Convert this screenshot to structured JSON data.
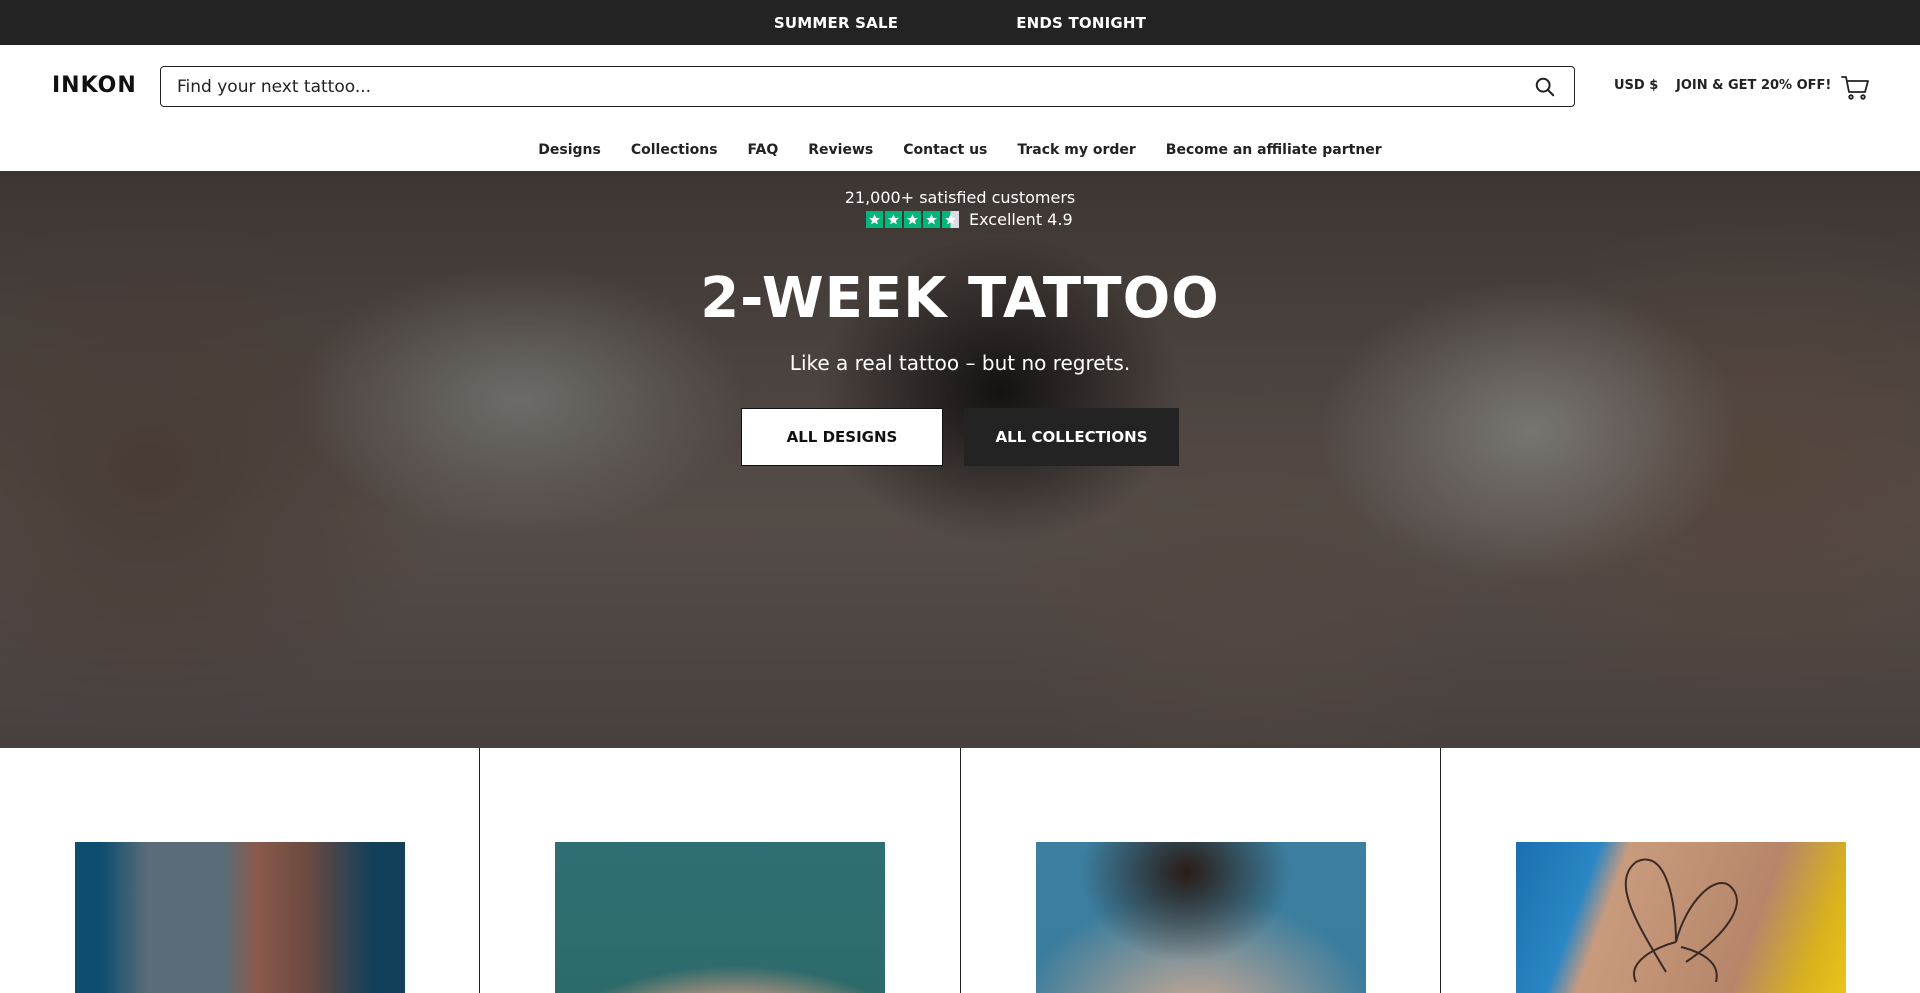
{
  "announcement": {
    "left": "SUMMER SALE",
    "right": "ENDS TONIGHT"
  },
  "header": {
    "logo": "INKON",
    "search_placeholder": "Find your next tattoo...",
    "currency": "USD $",
    "join": "JOIN & GET 20% OFF!"
  },
  "nav": {
    "items": [
      {
        "label": "Designs"
      },
      {
        "label": "Collections"
      },
      {
        "label": "FAQ"
      },
      {
        "label": "Reviews"
      },
      {
        "label": "Contact us"
      },
      {
        "label": "Track my order"
      },
      {
        "label": "Become an affiliate partner"
      }
    ]
  },
  "hero": {
    "customers": "21,000+ satisfied customers",
    "rating": "Excellent 4.9",
    "title": "2-WEEK TATTOO",
    "subtitle": "Like a real tattoo – but no regrets.",
    "btn_designs": "ALL DESIGNS",
    "btn_collections": "ALL COLLECTIONS"
  },
  "colors": {
    "announcement_bg": "#232323",
    "trustpilot_green": "#00b67a",
    "dark_button": "#232323"
  },
  "icons": {
    "search": "search-icon",
    "cart": "cart-icon",
    "star": "star-icon"
  }
}
